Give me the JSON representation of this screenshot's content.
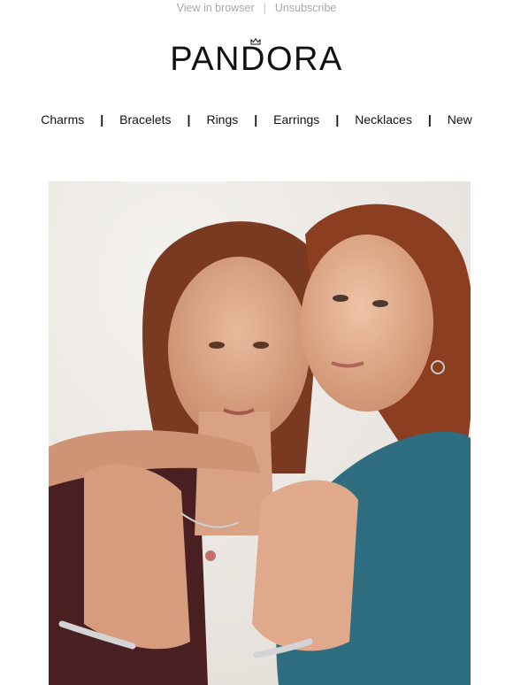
{
  "preheader": {
    "view_in_browser": "View in browser",
    "separator": "|",
    "unsubscribe": "Unsubscribe"
  },
  "brand": {
    "logo_text": "PANDORA"
  },
  "nav": {
    "items": [
      "Charms",
      "Bracelets",
      "Rings",
      "Earrings",
      "Necklaces",
      "New"
    ],
    "separator": "|"
  },
  "hero": {
    "image_name": "hero-photo-two-women-jewelry"
  },
  "colors": {
    "preheader_text": "#a8a8a8",
    "text": "#111111",
    "background": "#ffffff"
  }
}
